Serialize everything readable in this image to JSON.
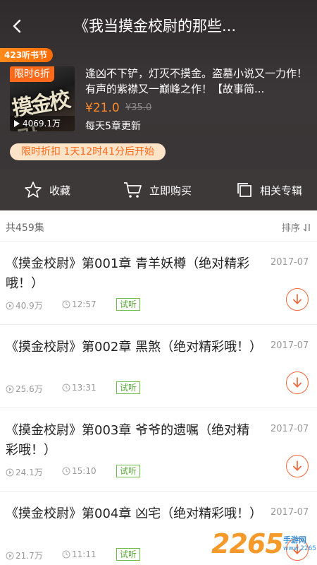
{
  "header": {
    "title": "《我当摸金校尉的那些..."
  },
  "book": {
    "festival_badge": "423听书节",
    "discount_tag": "限时6折",
    "cover_text": "摸金校尉",
    "play_count": "4069.1万",
    "description": "逢凶不下铲，灯灭不摸金。盗墓小说又一力作！有声的紫襟又一巅峰之作！【故事简...",
    "price": "¥21.0",
    "original_price": "¥35.0",
    "update_info": "每天5章更新",
    "discount_countdown": "限时折扣 1天12时41分后开始",
    "accent_color": "#ff6a1a"
  },
  "actions": {
    "favorite": "收藏",
    "buy_now": "立即购买",
    "related": "相关专辑"
  },
  "list": {
    "count": "共459集",
    "sort_label": "排序",
    "episodes": [
      {
        "title": "《摸金校尉》第001章 青羊妖樽（绝对精彩哦！）",
        "date": "2017-07",
        "plays": "40.9万",
        "duration": "12:57",
        "badge": "试听"
      },
      {
        "title": "《摸金校尉》第002章 黑煞（绝对精彩哦！）",
        "date": "2017-07",
        "plays": "25.6万",
        "duration": "13:31",
        "badge": "试听"
      },
      {
        "title": "《摸金校尉》第003章 爷爷的遗嘱（绝对精彩哦！）",
        "date": "2017-07",
        "plays": "24.1万",
        "duration": "15:10",
        "badge": "试听"
      },
      {
        "title": "《摸金校尉》第004章 凶宅（绝对精彩哦！）",
        "date": "2017-07",
        "plays": "21.7万",
        "duration": "11:11",
        "badge": "试听"
      }
    ]
  },
  "watermark": {
    "number": "2265",
    "text": "手游网",
    "url": "www.2265.com"
  }
}
